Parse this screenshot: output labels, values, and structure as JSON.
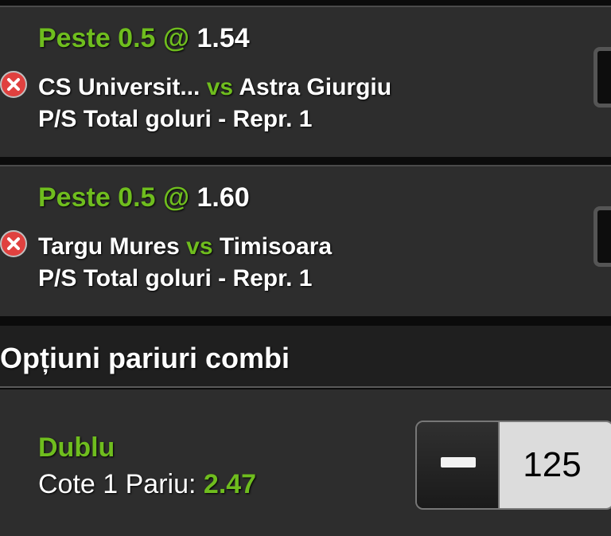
{
  "bets": [
    {
      "selection": "Peste 0.5",
      "at": "@",
      "odds": "1.54",
      "home": "CS Universit...",
      "vs": "vs",
      "away": "Astra Giurgiu",
      "market": "P/S Total goluri - Repr. 1",
      "remove_icon": "close-x-icon"
    },
    {
      "selection": "Peste 0.5",
      "at": "@",
      "odds": "1.60",
      "home": "Targu Mures",
      "vs": "vs",
      "away": "Timisoara",
      "market": "P/S Total goluri - Repr. 1",
      "remove_icon": "close-x-icon"
    }
  ],
  "combi": {
    "header": "Opțiuni pariuri combi",
    "type": "Dublu",
    "odds_label": "Cote 1 Pariu:",
    "odds_value": "2.47",
    "stake": "125",
    "minus_icon": "minus-icon"
  },
  "colors": {
    "accent_green": "#6fbd1e",
    "card_bg": "#2d2d2d",
    "remove_red": "#e0413f"
  }
}
